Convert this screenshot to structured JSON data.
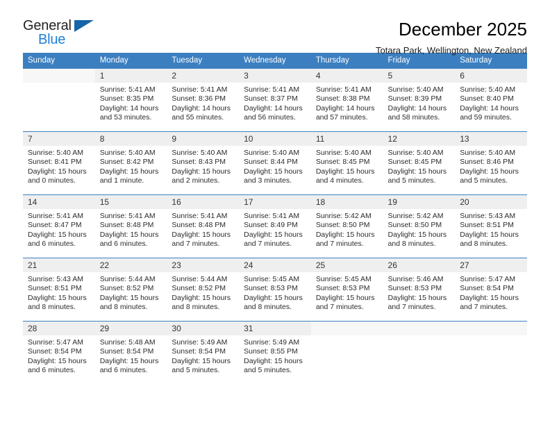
{
  "brand": {
    "name_top": "General",
    "name_bottom": "Blue",
    "triangle_color": "#1565a8",
    "blue_text_color": "#1c7fd6"
  },
  "header": {
    "title": "December 2025",
    "subtitle": "Totara Park, Wellington, New Zealand",
    "header_bg_color": "#3c7fc0",
    "header_text_color": "#ffffff"
  },
  "weekday_headers": [
    "Sunday",
    "Monday",
    "Tuesday",
    "Wednesday",
    "Thursday",
    "Friday",
    "Saturday"
  ],
  "labels": {
    "sunrise_prefix": "Sunrise:",
    "sunset_prefix": "Sunset:",
    "daylight_prefix": "Daylight:"
  },
  "weeks": [
    [
      {
        "day": "",
        "empty": true,
        "sunrise": "",
        "sunset": "",
        "daylight_line1": "",
        "daylight_line2": ""
      },
      {
        "day": "1",
        "sunrise": "Sunrise: 5:41 AM",
        "sunset": "Sunset: 8:35 PM",
        "daylight_line1": "Daylight: 14 hours",
        "daylight_line2": "and 53 minutes."
      },
      {
        "day": "2",
        "sunrise": "Sunrise: 5:41 AM",
        "sunset": "Sunset: 8:36 PM",
        "daylight_line1": "Daylight: 14 hours",
        "daylight_line2": "and 55 minutes."
      },
      {
        "day": "3",
        "sunrise": "Sunrise: 5:41 AM",
        "sunset": "Sunset: 8:37 PM",
        "daylight_line1": "Daylight: 14 hours",
        "daylight_line2": "and 56 minutes."
      },
      {
        "day": "4",
        "sunrise": "Sunrise: 5:41 AM",
        "sunset": "Sunset: 8:38 PM",
        "daylight_line1": "Daylight: 14 hours",
        "daylight_line2": "and 57 minutes."
      },
      {
        "day": "5",
        "sunrise": "Sunrise: 5:40 AM",
        "sunset": "Sunset: 8:39 PM",
        "daylight_line1": "Daylight: 14 hours",
        "daylight_line2": "and 58 minutes."
      },
      {
        "day": "6",
        "sunrise": "Sunrise: 5:40 AM",
        "sunset": "Sunset: 8:40 PM",
        "daylight_line1": "Daylight: 14 hours",
        "daylight_line2": "and 59 minutes."
      }
    ],
    [
      {
        "day": "7",
        "sunrise": "Sunrise: 5:40 AM",
        "sunset": "Sunset: 8:41 PM",
        "daylight_line1": "Daylight: 15 hours",
        "daylight_line2": "and 0 minutes."
      },
      {
        "day": "8",
        "sunrise": "Sunrise: 5:40 AM",
        "sunset": "Sunset: 8:42 PM",
        "daylight_line1": "Daylight: 15 hours",
        "daylight_line2": "and 1 minute."
      },
      {
        "day": "9",
        "sunrise": "Sunrise: 5:40 AM",
        "sunset": "Sunset: 8:43 PM",
        "daylight_line1": "Daylight: 15 hours",
        "daylight_line2": "and 2 minutes."
      },
      {
        "day": "10",
        "sunrise": "Sunrise: 5:40 AM",
        "sunset": "Sunset: 8:44 PM",
        "daylight_line1": "Daylight: 15 hours",
        "daylight_line2": "and 3 minutes."
      },
      {
        "day": "11",
        "sunrise": "Sunrise: 5:40 AM",
        "sunset": "Sunset: 8:45 PM",
        "daylight_line1": "Daylight: 15 hours",
        "daylight_line2": "and 4 minutes."
      },
      {
        "day": "12",
        "sunrise": "Sunrise: 5:40 AM",
        "sunset": "Sunset: 8:45 PM",
        "daylight_line1": "Daylight: 15 hours",
        "daylight_line2": "and 5 minutes."
      },
      {
        "day": "13",
        "sunrise": "Sunrise: 5:40 AM",
        "sunset": "Sunset: 8:46 PM",
        "daylight_line1": "Daylight: 15 hours",
        "daylight_line2": "and 5 minutes."
      }
    ],
    [
      {
        "day": "14",
        "sunrise": "Sunrise: 5:41 AM",
        "sunset": "Sunset: 8:47 PM",
        "daylight_line1": "Daylight: 15 hours",
        "daylight_line2": "and 6 minutes."
      },
      {
        "day": "15",
        "sunrise": "Sunrise: 5:41 AM",
        "sunset": "Sunset: 8:48 PM",
        "daylight_line1": "Daylight: 15 hours",
        "daylight_line2": "and 6 minutes."
      },
      {
        "day": "16",
        "sunrise": "Sunrise: 5:41 AM",
        "sunset": "Sunset: 8:48 PM",
        "daylight_line1": "Daylight: 15 hours",
        "daylight_line2": "and 7 minutes."
      },
      {
        "day": "17",
        "sunrise": "Sunrise: 5:41 AM",
        "sunset": "Sunset: 8:49 PM",
        "daylight_line1": "Daylight: 15 hours",
        "daylight_line2": "and 7 minutes."
      },
      {
        "day": "18",
        "sunrise": "Sunrise: 5:42 AM",
        "sunset": "Sunset: 8:50 PM",
        "daylight_line1": "Daylight: 15 hours",
        "daylight_line2": "and 7 minutes."
      },
      {
        "day": "19",
        "sunrise": "Sunrise: 5:42 AM",
        "sunset": "Sunset: 8:50 PM",
        "daylight_line1": "Daylight: 15 hours",
        "daylight_line2": "and 8 minutes."
      },
      {
        "day": "20",
        "sunrise": "Sunrise: 5:43 AM",
        "sunset": "Sunset: 8:51 PM",
        "daylight_line1": "Daylight: 15 hours",
        "daylight_line2": "and 8 minutes."
      }
    ],
    [
      {
        "day": "21",
        "sunrise": "Sunrise: 5:43 AM",
        "sunset": "Sunset: 8:51 PM",
        "daylight_line1": "Daylight: 15 hours",
        "daylight_line2": "and 8 minutes."
      },
      {
        "day": "22",
        "sunrise": "Sunrise: 5:44 AM",
        "sunset": "Sunset: 8:52 PM",
        "daylight_line1": "Daylight: 15 hours",
        "daylight_line2": "and 8 minutes."
      },
      {
        "day": "23",
        "sunrise": "Sunrise: 5:44 AM",
        "sunset": "Sunset: 8:52 PM",
        "daylight_line1": "Daylight: 15 hours",
        "daylight_line2": "and 8 minutes."
      },
      {
        "day": "24",
        "sunrise": "Sunrise: 5:45 AM",
        "sunset": "Sunset: 8:53 PM",
        "daylight_line1": "Daylight: 15 hours",
        "daylight_line2": "and 8 minutes."
      },
      {
        "day": "25",
        "sunrise": "Sunrise: 5:45 AM",
        "sunset": "Sunset: 8:53 PM",
        "daylight_line1": "Daylight: 15 hours",
        "daylight_line2": "and 7 minutes."
      },
      {
        "day": "26",
        "sunrise": "Sunrise: 5:46 AM",
        "sunset": "Sunset: 8:53 PM",
        "daylight_line1": "Daylight: 15 hours",
        "daylight_line2": "and 7 minutes."
      },
      {
        "day": "27",
        "sunrise": "Sunrise: 5:47 AM",
        "sunset": "Sunset: 8:54 PM",
        "daylight_line1": "Daylight: 15 hours",
        "daylight_line2": "and 7 minutes."
      }
    ],
    [
      {
        "day": "28",
        "sunrise": "Sunrise: 5:47 AM",
        "sunset": "Sunset: 8:54 PM",
        "daylight_line1": "Daylight: 15 hours",
        "daylight_line2": "and 6 minutes."
      },
      {
        "day": "29",
        "sunrise": "Sunrise: 5:48 AM",
        "sunset": "Sunset: 8:54 PM",
        "daylight_line1": "Daylight: 15 hours",
        "daylight_line2": "and 6 minutes."
      },
      {
        "day": "30",
        "sunrise": "Sunrise: 5:49 AM",
        "sunset": "Sunset: 8:54 PM",
        "daylight_line1": "Daylight: 15 hours",
        "daylight_line2": "and 5 minutes."
      },
      {
        "day": "31",
        "sunrise": "Sunrise: 5:49 AM",
        "sunset": "Sunset: 8:55 PM",
        "daylight_line1": "Daylight: 15 hours",
        "daylight_line2": "and 5 minutes."
      },
      {
        "day": "",
        "empty": true,
        "sunrise": "",
        "sunset": "",
        "daylight_line1": "",
        "daylight_line2": ""
      },
      {
        "day": "",
        "empty": true,
        "sunrise": "",
        "sunset": "",
        "daylight_line1": "",
        "daylight_line2": ""
      },
      {
        "day": "",
        "empty": true,
        "sunrise": "",
        "sunset": "",
        "daylight_line1": "",
        "daylight_line2": ""
      }
    ]
  ]
}
